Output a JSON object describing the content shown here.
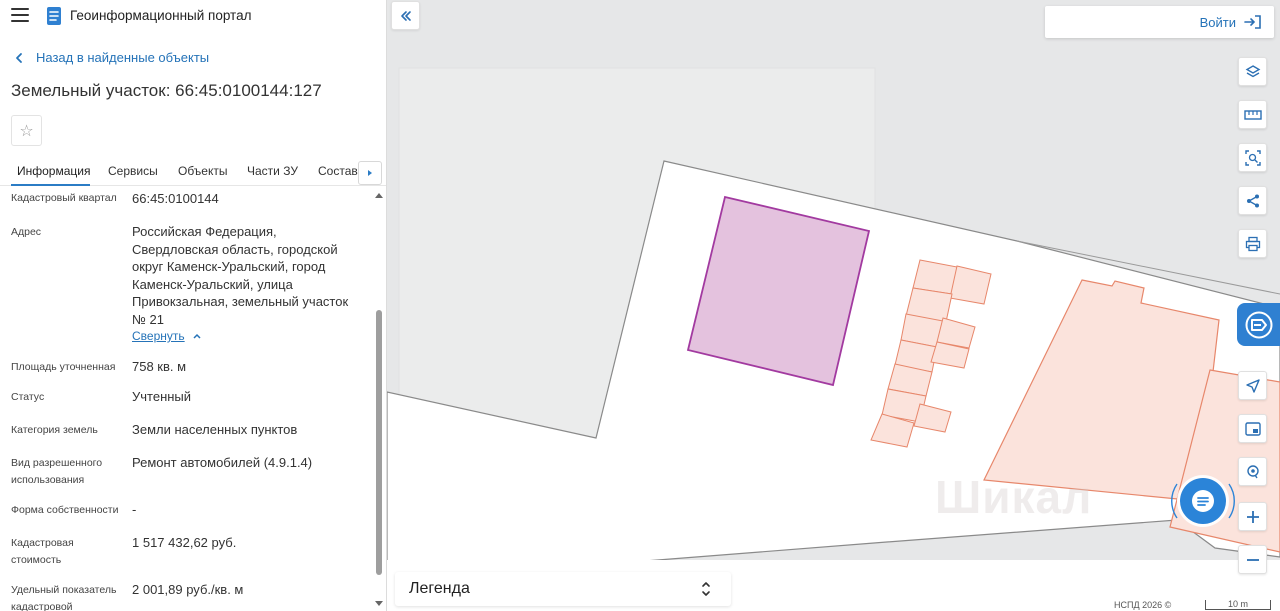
{
  "header": {
    "app_title": "Геоинформационный портал"
  },
  "navigation": {
    "back_label": "Назад в найденные объекты"
  },
  "object": {
    "title": "Земельный участок: 66:45:0100144:127"
  },
  "tabs": [
    {
      "label": "Информация",
      "active": true
    },
    {
      "label": "Сервисы",
      "active": false
    },
    {
      "label": "Объекты",
      "active": false
    },
    {
      "label": "Части ЗУ",
      "active": false
    },
    {
      "label": "Состав",
      "active": false
    }
  ],
  "properties": {
    "cadastral_quarter": {
      "label": "Кадастровый квартал",
      "value": "66:45:0100144"
    },
    "address": {
      "label": "Адрес",
      "value": "Российская Федерация, Свердловская область, городской округ Каменск-Уральский, город Каменск-Уральский, улица Привокзальная, земельный участок № 21",
      "collapse_label": "Свернуть"
    },
    "area": {
      "label": "Площадь уточненная",
      "value": "758 кв. м"
    },
    "status": {
      "label": "Статус",
      "value": "Учтенный"
    },
    "land_category": {
      "label": "Категория земель",
      "value": "Земли населенных пунктов"
    },
    "permitted_use": {
      "label": "Вид разрешенного использования",
      "value": "Ремонт автомобилей (4.9.1.4)"
    },
    "ownership": {
      "label": "Форма собственности",
      "value": "-"
    },
    "cadastral_value": {
      "label": "Кадастровая стоимость",
      "value": "1 517 432,62 руб."
    },
    "specific_value": {
      "label": "Удельный показатель кадастровой",
      "value": "2 001,89 руб./кв. м"
    }
  },
  "map": {
    "login_label": "Войти",
    "legend_label": "Легенда",
    "attribution": "НСПД 2026 ©",
    "scale_label": "10 m",
    "watermark": "Шикал",
    "tools": [
      "layers-icon",
      "ruler-icon",
      "area-select-icon",
      "share-icon",
      "print-icon",
      "navigate-icon",
      "minimap-icon",
      "locate-icon",
      "zoom-in-icon",
      "zoom-out-icon"
    ],
    "colors": {
      "selected_parcel_fill": "#e4c2de",
      "selected_parcel_stroke": "#a23aa0",
      "building_fill": "#fbe3dc",
      "building_stroke": "#e7876b",
      "background_gray": "#e6e7e8",
      "accent_blue": "#2b84d8"
    }
  }
}
